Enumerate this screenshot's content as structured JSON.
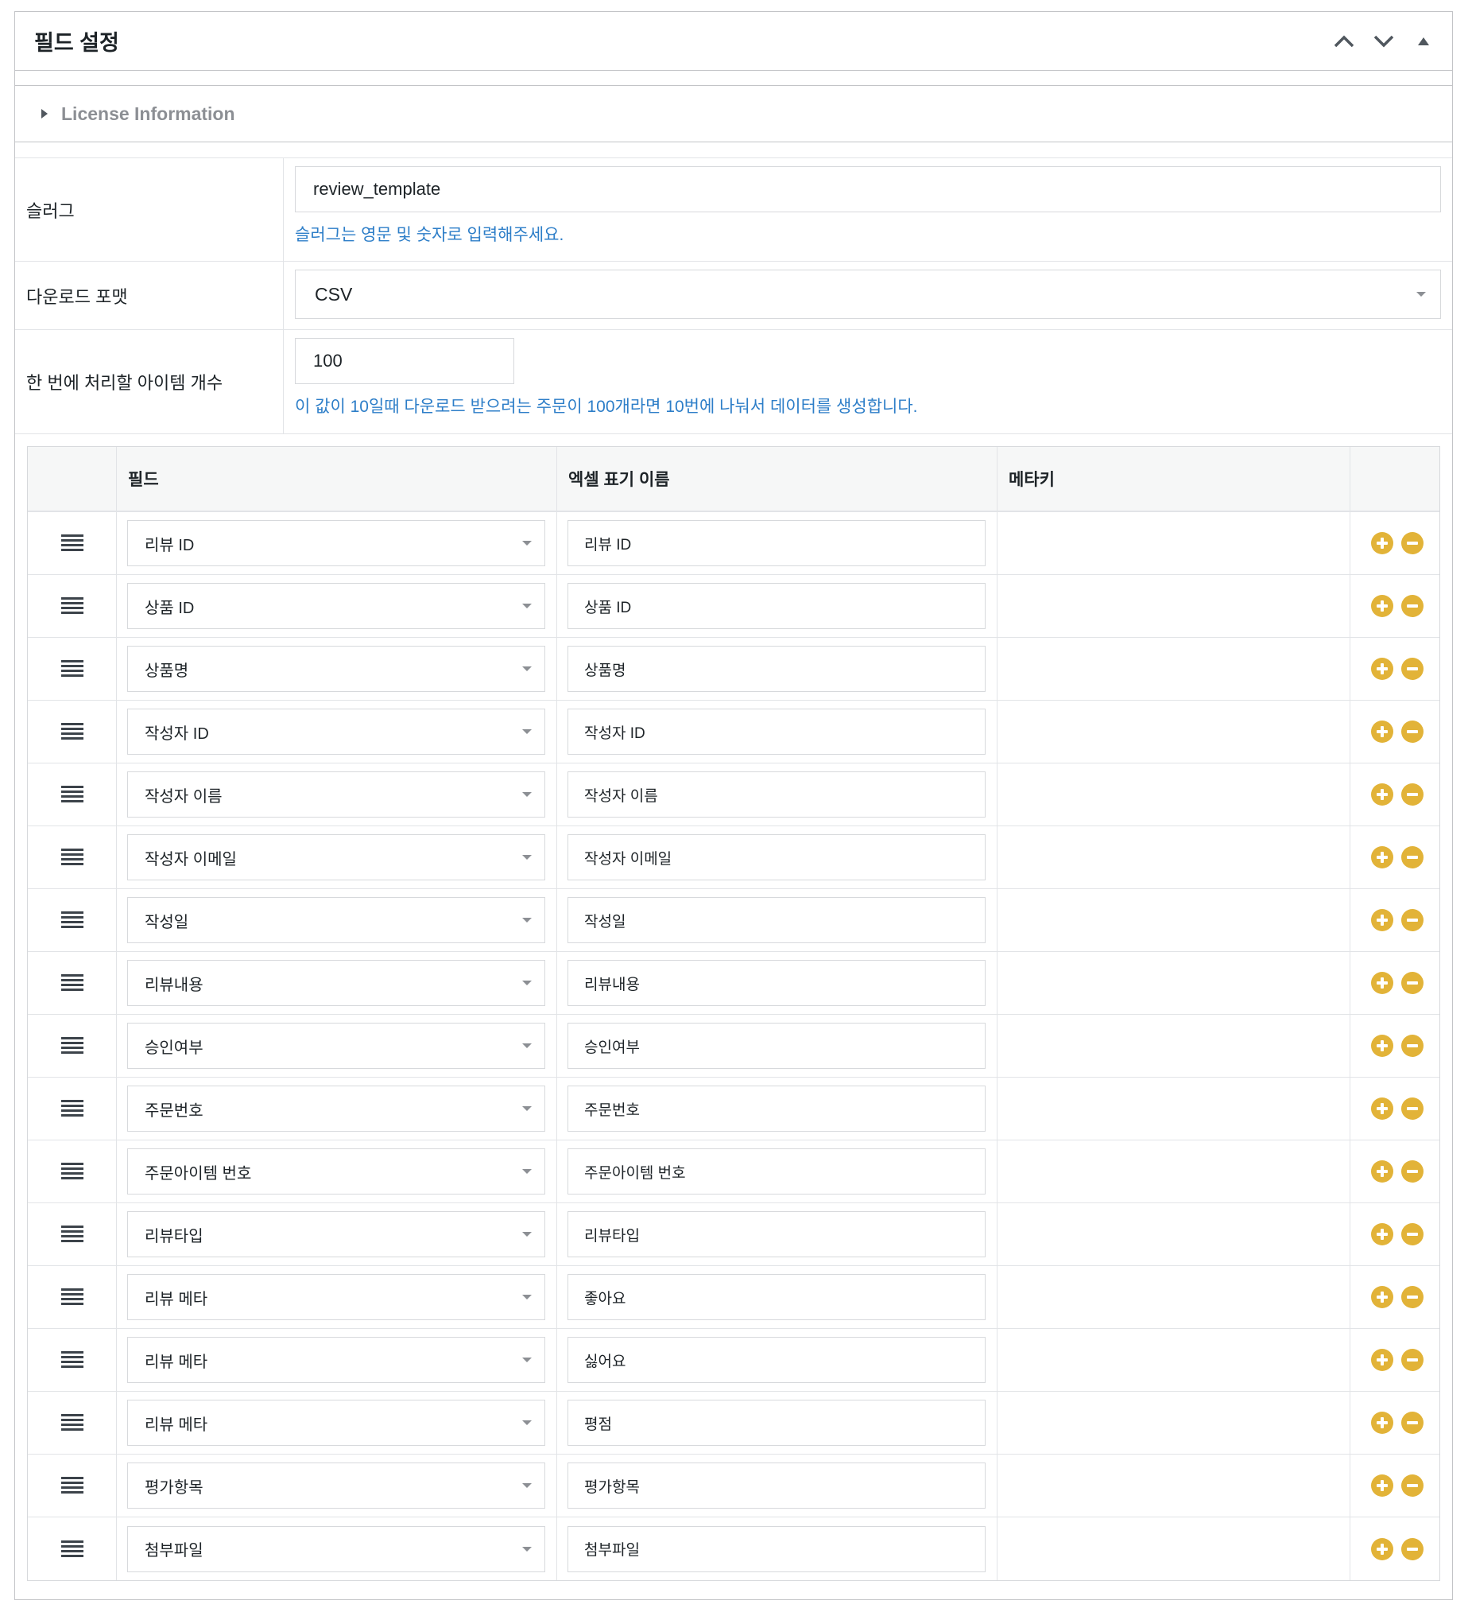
{
  "panel": {
    "title": "필드 설정",
    "actions": [
      "chevron-up-icon",
      "chevron-down-icon",
      "triangle-up-icon"
    ]
  },
  "license": {
    "label": "License Information"
  },
  "form": {
    "slug": {
      "label": "슬러그",
      "value": "review_template",
      "help": "슬러그는 영문 및 숫자로 입력해주세요."
    },
    "format": {
      "label": "다운로드 포맷",
      "value": "CSV"
    },
    "batch": {
      "label": "한 번에 처리할 아이템 개수",
      "value": "100",
      "help": "이 값이 10일때 다운로드 받으려는 주문이 100개라면 10번에 나눠서 데이터를 생성합니다."
    }
  },
  "table": {
    "headers": {
      "field": "필드",
      "excel": "엑셀 표기 이름",
      "metakey": "메타키"
    },
    "rows": [
      {
        "field": "리뷰 ID",
        "excel": "리뷰 ID"
      },
      {
        "field": "상품 ID",
        "excel": "상품 ID"
      },
      {
        "field": "상품명",
        "excel": "상품명"
      },
      {
        "field": "작성자 ID",
        "excel": "작성자 ID"
      },
      {
        "field": "작성자 이름",
        "excel": "작성자 이름"
      },
      {
        "field": "작성자 이메일",
        "excel": "작성자 이메일"
      },
      {
        "field": "작성일",
        "excel": "작성일"
      },
      {
        "field": "리뷰내용",
        "excel": "리뷰내용"
      },
      {
        "field": "승인여부",
        "excel": "승인여부"
      },
      {
        "field": "주문번호",
        "excel": "주문번호"
      },
      {
        "field": "주문아이템 번호",
        "excel": "주문아이템 번호"
      },
      {
        "field": "리뷰타입",
        "excel": "리뷰타입"
      },
      {
        "field": "리뷰 메타",
        "excel": "좋아요"
      },
      {
        "field": "리뷰 메타",
        "excel": "싫어요"
      },
      {
        "field": "리뷰 메타",
        "excel": "평점"
      },
      {
        "field": "평가항목",
        "excel": "평가항목"
      },
      {
        "field": "첨부파일",
        "excel": "첨부파일"
      }
    ]
  },
  "colors": {
    "accent": "#e2b338",
    "help": "#2d7ec8",
    "border": "#d7d9dc"
  }
}
